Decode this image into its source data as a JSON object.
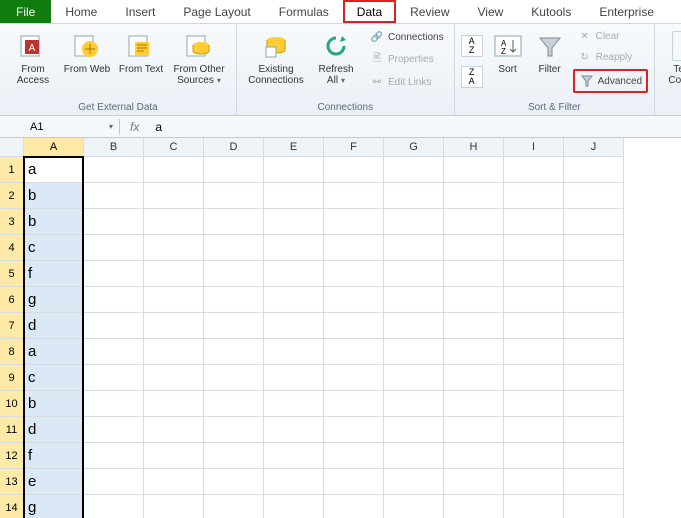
{
  "tabs": {
    "file": "File",
    "home": "Home",
    "insert": "Insert",
    "page_layout": "Page Layout",
    "formulas": "Formulas",
    "data": "Data",
    "review": "Review",
    "view": "View",
    "kutools": "Kutools",
    "enterprise": "Enterprise"
  },
  "ribbon": {
    "get_external_data": {
      "label": "Get External Data",
      "from_access": "From\nAccess",
      "from_web": "From\nWeb",
      "from_text": "From\nText",
      "from_other": "From Other\nSources"
    },
    "connections": {
      "label": "Connections",
      "existing": "Existing\nConnections",
      "refresh": "Refresh\nAll",
      "connections_btn": "Connections",
      "properties": "Properties",
      "edit_links": "Edit Links"
    },
    "sort_filter": {
      "label": "Sort & Filter",
      "sort": "Sort",
      "filter": "Filter",
      "clear": "Clear",
      "reapply": "Reapply",
      "advanced": "Advanced"
    },
    "data_tools": {
      "text_to_columns": "Text to\nColumns"
    }
  },
  "namebox": "A1",
  "formula": "a",
  "columns": [
    "A",
    "B",
    "C",
    "D",
    "E",
    "F",
    "G",
    "H",
    "I",
    "J"
  ],
  "rows": [
    {
      "n": 1,
      "v": "a"
    },
    {
      "n": 2,
      "v": "b"
    },
    {
      "n": 3,
      "v": "b"
    },
    {
      "n": 4,
      "v": "c"
    },
    {
      "n": 5,
      "v": "f"
    },
    {
      "n": 6,
      "v": "g"
    },
    {
      "n": 7,
      "v": "d"
    },
    {
      "n": 8,
      "v": "a"
    },
    {
      "n": 9,
      "v": "c"
    },
    {
      "n": 10,
      "v": "b"
    },
    {
      "n": 11,
      "v": "d"
    },
    {
      "n": 12,
      "v": "f"
    },
    {
      "n": 13,
      "v": "e"
    },
    {
      "n": 14,
      "v": "g"
    }
  ]
}
